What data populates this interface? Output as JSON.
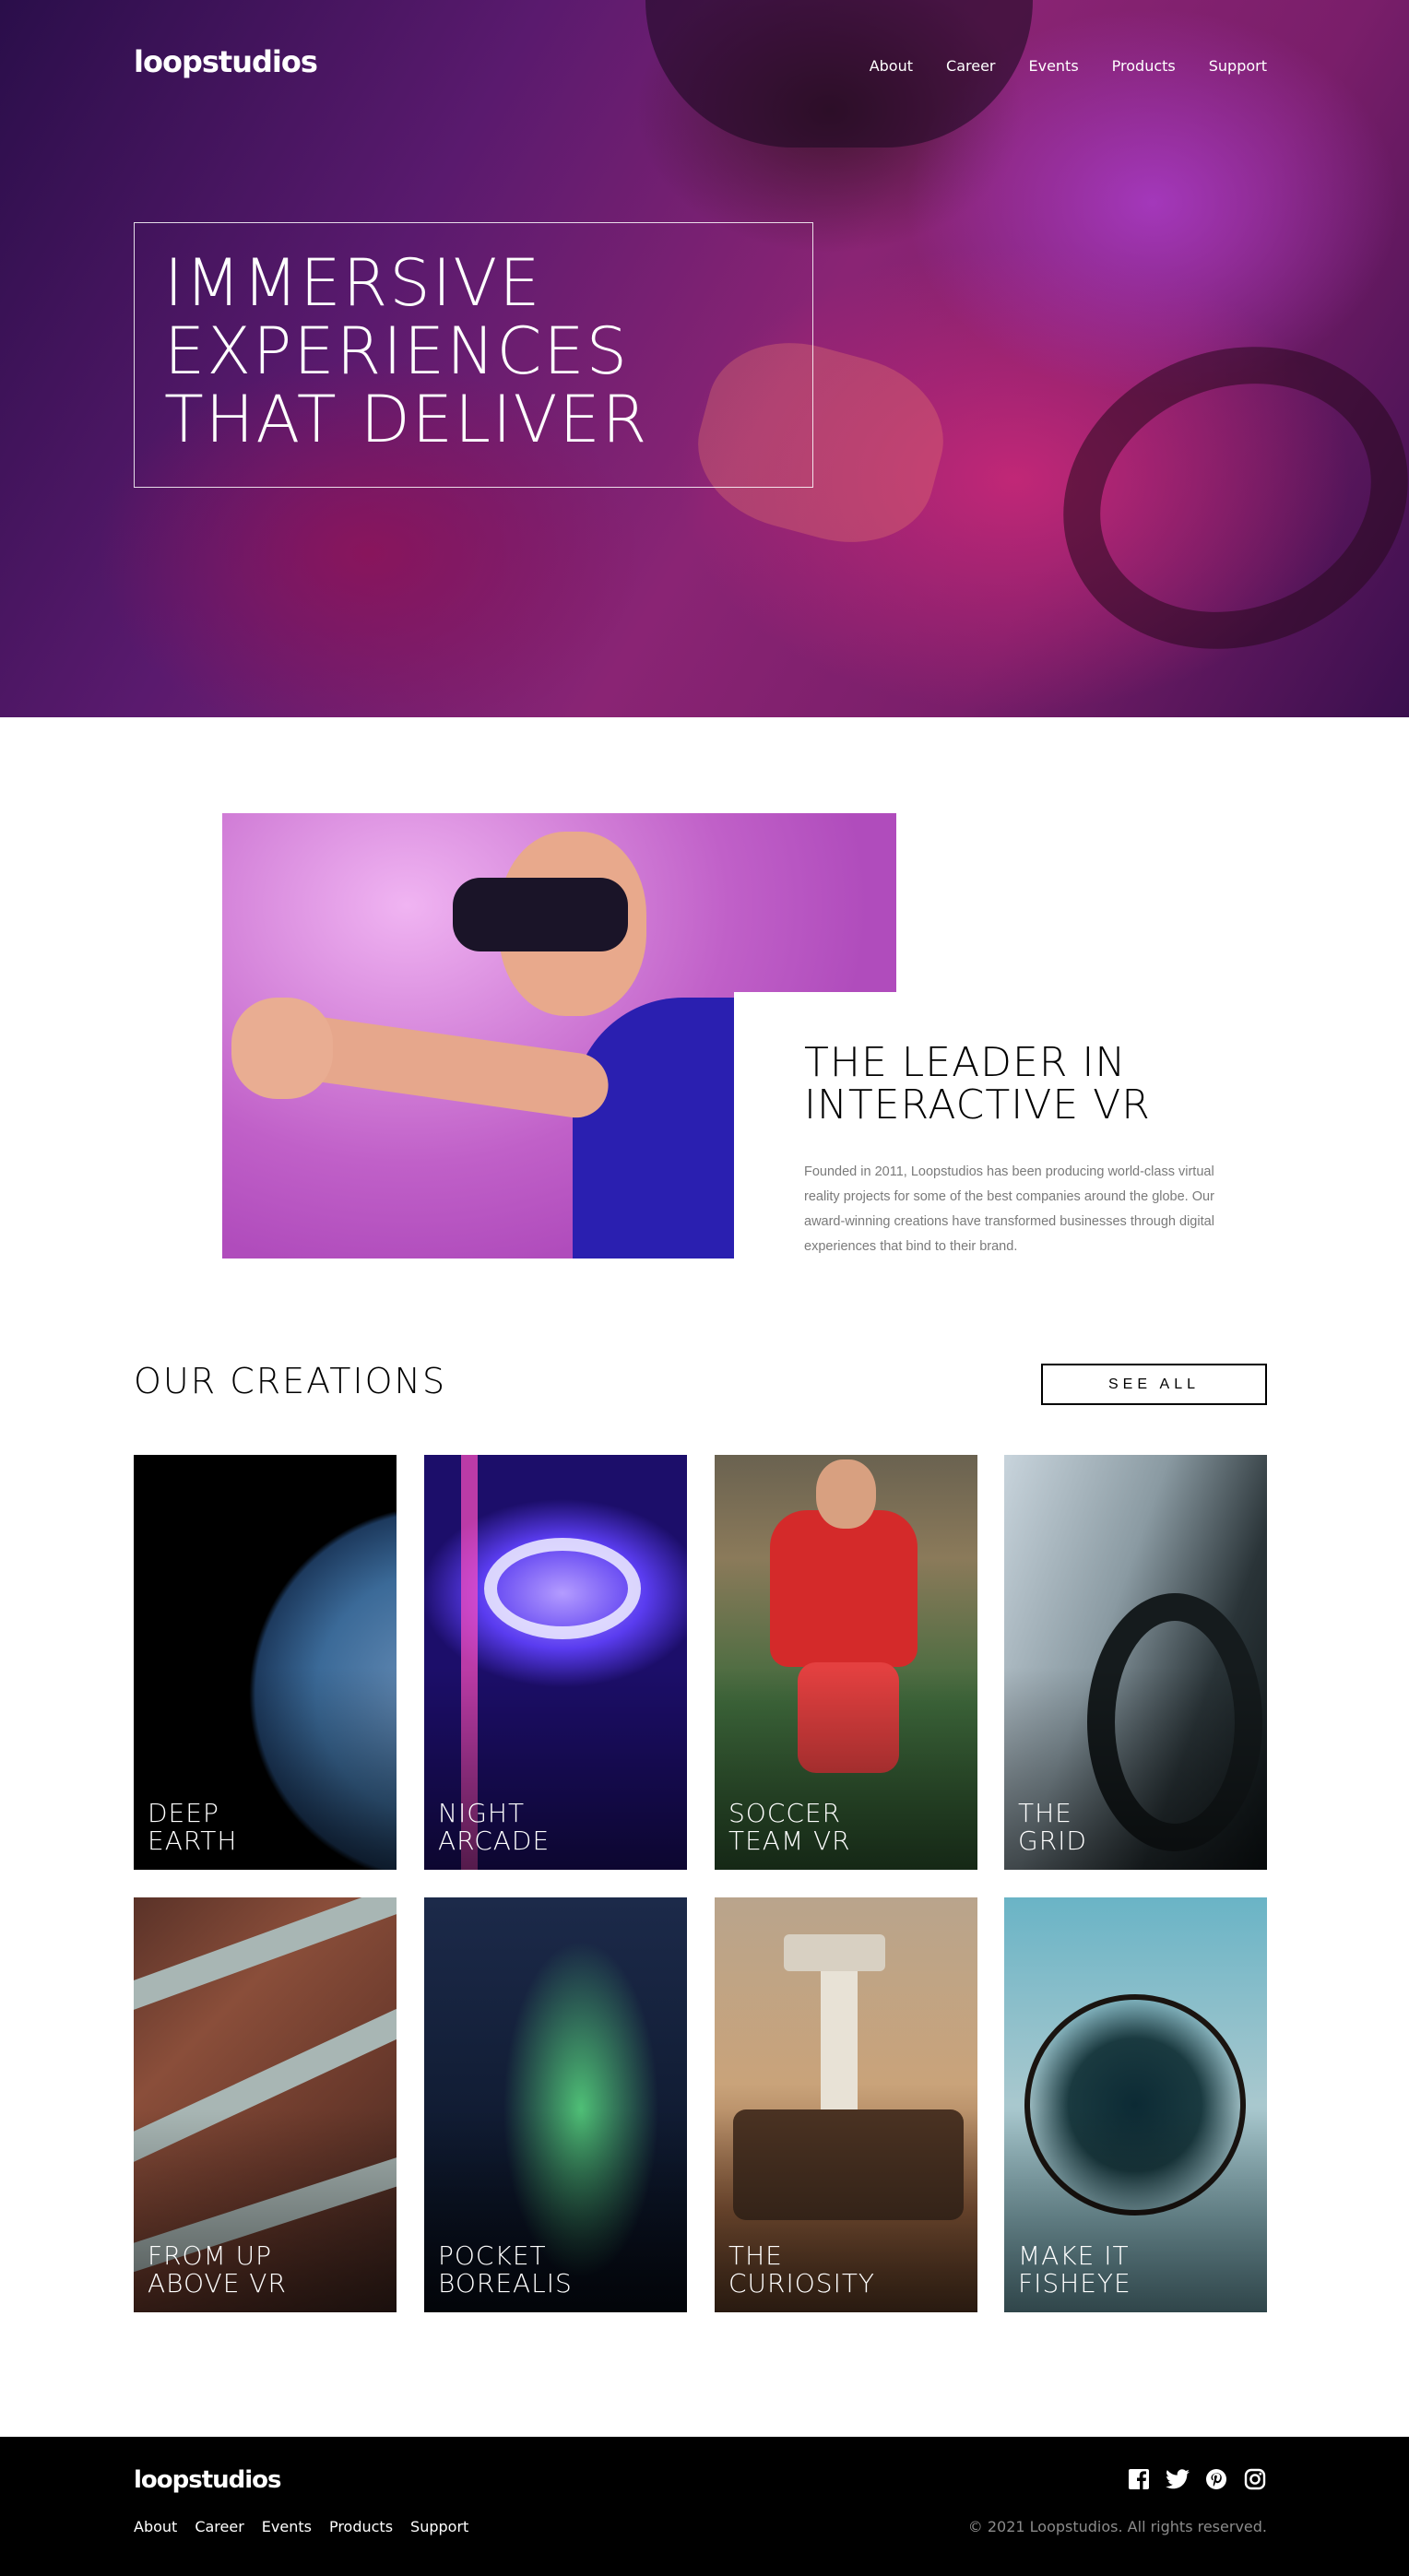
{
  "brand": {
    "logo": "loopstudios"
  },
  "nav": {
    "items": [
      "About",
      "Career",
      "Events",
      "Products",
      "Support"
    ]
  },
  "hero": {
    "title": "IMMERSIVE\nEXPERIENCES\nTHAT DELIVER"
  },
  "about": {
    "title": "THE LEADER IN\nINTERACTIVE VR",
    "text": "Founded in 2011, Loopstudios has been producing world-class virtual reality projects for some of the best companies around the globe. Our award-winning creations have transformed businesses through digital experiences that bind to their brand."
  },
  "creations": {
    "title": "OUR CREATIONS",
    "see_all": "SEE ALL",
    "items": [
      {
        "label": "DEEP\nEARTH"
      },
      {
        "label": "NIGHT\nARCADE"
      },
      {
        "label": "SOCCER\nTEAM VR"
      },
      {
        "label": "THE\nGRID"
      },
      {
        "label": "FROM UP\nABOVE VR"
      },
      {
        "label": "POCKET\nBOREALIS"
      },
      {
        "label": "THE\nCURIOSITY"
      },
      {
        "label": "MAKE IT\nFISHEYE"
      }
    ]
  },
  "footer": {
    "logo": "loopstudios",
    "nav": [
      "About",
      "Career",
      "Events",
      "Products",
      "Support"
    ],
    "social_icons": [
      "facebook-icon",
      "twitter-icon",
      "pinterest-icon",
      "instagram-icon"
    ],
    "copyright": "© 2021 Loopstudios. All rights reserved."
  }
}
